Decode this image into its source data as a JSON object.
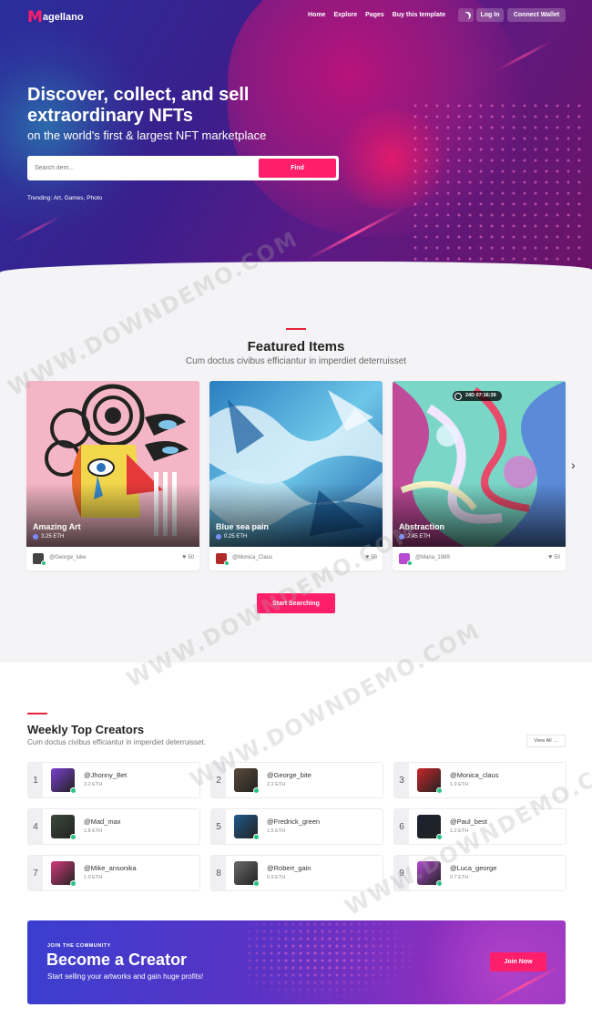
{
  "header": {
    "logo_mark": "M",
    "logo_text": "agellano",
    "nav": [
      "Home",
      "Explore",
      "Pages",
      "Buy this template"
    ],
    "login_label": "Log In",
    "wallet_label": "Connect Wallet"
  },
  "hero": {
    "title": "Discover, collect, and sell extraordinary NFTs",
    "subtitle": "on the world's first & largest NFT marketplace",
    "search_placeholder": "Search item...",
    "search_button": "Find",
    "trending": "Trending: Art, Games, Photo"
  },
  "featured": {
    "title": "Featured Items",
    "subtitle": "Cum doctus civibus efficiantur in imperdiet deterruisset",
    "items": [
      {
        "name": "Amazing Art",
        "price": "3.25 ETH",
        "user": "@George_luke",
        "likes": "50"
      },
      {
        "name": "Blue sea pain",
        "price": "0.25 ETH",
        "user": "@Monica_Claus",
        "likes": "50"
      },
      {
        "name": "Abstraction",
        "price": "2.45 ETH",
        "user": "@Maria_1989",
        "likes": "50",
        "timer": "24D 07:16:39"
      }
    ],
    "cta": "Start Searching"
  },
  "creators": {
    "title": "Weekly Top Creators",
    "subtitle": "Cum doctus civibus efficiantur in imperdiet deterruisset.",
    "view_all": "View All →",
    "list": [
      {
        "rank": "1",
        "name": "@Jhonny_Bet",
        "eth": "3.2 ETH",
        "color": "#7a3fd0"
      },
      {
        "rank": "2",
        "name": "@George_bite",
        "eth": "2.2 ETH",
        "color": "#5a4a3a"
      },
      {
        "rank": "3",
        "name": "@Monica_claus",
        "eth": "1.9 ETH",
        "color": "#c8262a"
      },
      {
        "rank": "4",
        "name": "@Mad_max",
        "eth": "1.8 ETH",
        "color": "#3b4a3a"
      },
      {
        "rank": "5",
        "name": "@Fredrick_green",
        "eth": "1.5 ETH",
        "color": "#1f5a8a"
      },
      {
        "rank": "6",
        "name": "@Paul_best",
        "eth": "1.2 ETH",
        "color": "#1a2230"
      },
      {
        "rank": "7",
        "name": "@Mike_ansonika",
        "eth": "1.0 ETH",
        "color": "#d23a7a"
      },
      {
        "rank": "8",
        "name": "@Robert_gain",
        "eth": "0.9 ETH",
        "color": "#6a6a6a"
      },
      {
        "rank": "9",
        "name": "@Luca_george",
        "eth": "0.7 ETH",
        "color": "#b04ad0"
      }
    ]
  },
  "banner": {
    "kicker": "JOIN THE COMMUNITY",
    "title": "Become a Creator",
    "subtitle": "Start selling your artworks and gain huge profits!",
    "button": "Join Now"
  },
  "watermark": "WWW.DOWNDEMO.COM"
}
